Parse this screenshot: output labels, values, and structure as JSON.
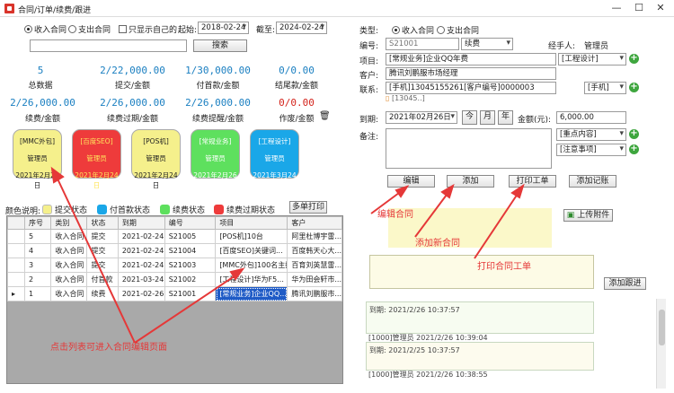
{
  "window": {
    "title": "合同/订单/续费/跟进"
  },
  "filter": {
    "radio_in": "收入合同",
    "radio_out": "支出合同",
    "only_mine": "只显示自己的",
    "start_label": "起始:",
    "start_date": "2018-02-24",
    "end_label": "截至:",
    "end_date": "2024-02-24",
    "search_value": "",
    "search_button": "搜索"
  },
  "stats": [
    {
      "value": "5",
      "label": "总数据"
    },
    {
      "value": "2/22,000.00",
      "label": "提交/金额"
    },
    {
      "value": "1/30,000.00",
      "label": "付首款/金额"
    },
    {
      "value": "0/0.00",
      "label": "结尾款/金额"
    },
    {
      "value": "2/26,000.00",
      "label": "续费/金额"
    },
    {
      "value": "2/26,000.00",
      "label": "续费过期/金额"
    },
    {
      "value": "2/26,000.00",
      "label": "续费提醒/金额"
    },
    {
      "value": "0/0.00",
      "label": "作废/金额"
    }
  ],
  "cards": [
    {
      "tag": "[MMC外包]",
      "owner": "管理员",
      "date": "2021年2月24日",
      "color": "#f5f08c"
    },
    {
      "tag": "[百度SEO]",
      "owner": "管理员",
      "date": "2021年2月24日",
      "color": "#ee3b3b"
    },
    {
      "tag": "[POS机]",
      "owner": "管理员",
      "date": "2021年2月24日",
      "color": "#f5f08c"
    },
    {
      "tag": "[常规业务]",
      "owner": "管理员",
      "date": "2021年2月26日",
      "color": "#5ee05e"
    },
    {
      "tag": "[工程设计]",
      "owner": "管理员",
      "date": "2021年3月24日",
      "color": "#1aa7e8"
    }
  ],
  "legend": {
    "title": "颜色说明:",
    "items": [
      {
        "label": "提交状态",
        "color": "#f5f08c"
      },
      {
        "label": "付首款状态",
        "color": "#1aa7e8"
      },
      {
        "label": "续费状态",
        "color": "#5ee05e"
      },
      {
        "label": "续费过期状态",
        "color": "#ee3b3b"
      }
    ],
    "print_button": "多单打印"
  },
  "table": {
    "headers": [
      "序号",
      "类别",
      "状态",
      "到期",
      "编号",
      "项目",
      "客户"
    ],
    "rows": [
      [
        "5",
        "收入合同",
        "提交",
        "2021-02-24",
        "S21005",
        "[POS机]10台",
        "阿里杜博宇雷..."
      ],
      [
        "4",
        "收入合同",
        "提交",
        "2021-02-24",
        "S21004",
        "[百度SEO]关键词...",
        "百度韩天心大..."
      ],
      [
        "3",
        "收入合同",
        "提交",
        "2021-02-24",
        "S21003",
        "[MMC外包]100名主播",
        "百育刘英慧雷..."
      ],
      [
        "2",
        "收入合同",
        "付首款",
        "2021-03-24",
        "S21002",
        "[工程设计]华为F5...",
        "华为田会轩市..."
      ],
      [
        "1",
        "收入合同",
        "续费",
        "2021-02-26",
        "S21001",
        "[常规业务]企业QQ...",
        "腾讯刘鹏服市..."
      ]
    ]
  },
  "form": {
    "type_label": "类型:",
    "type_in": "收入合同",
    "type_out": "支出合同",
    "code_label": "编号:",
    "code_value": "S21001",
    "status_value": "续费",
    "handler_label": "经手人:",
    "handler_value": "管理员",
    "project_label": "项目:",
    "project_value": "[常规业务]企业QQ年费",
    "project_cat": "[工程设计]",
    "client_label": "客户:",
    "client_value": "腾讯刘鹏服市场经理",
    "contact_label": "联系:",
    "contact_value": "[手机]13045155261[客户编号]0000003",
    "contact_type": "[手机]",
    "phone_hint": "[13045..]",
    "due_label": "到期:",
    "due_value": "2021年02月26日",
    "btn_today": "今",
    "btn_month": "月",
    "btn_year": "年",
    "amount_label": "金额(元):",
    "amount_value": "6,000.00",
    "note_label": "备注:",
    "note_value": "",
    "note_key": "[重点内容]",
    "note_attention": "[注意事项]"
  },
  "actions": {
    "edit": "编辑",
    "add": "添加",
    "print": "打印工单",
    "add_record": "添加记账"
  },
  "annotations": {
    "edit": "编辑合同",
    "add": "添加新合同",
    "print": "打印合同工单",
    "list": "点击列表可进入合同编辑页面"
  },
  "attach_button": "上传附件",
  "followup_button": "添加跟进",
  "logs": [
    {
      "line1": "到期: 2021/2/26 10:37:57",
      "line2": "[1000]管理员   2021/2/26 10:39:04"
    },
    {
      "line1": "到期: 2021/2/25 10:37:57",
      "line2": "[1000]管理员   2021/2/26 10:38:55"
    }
  ]
}
